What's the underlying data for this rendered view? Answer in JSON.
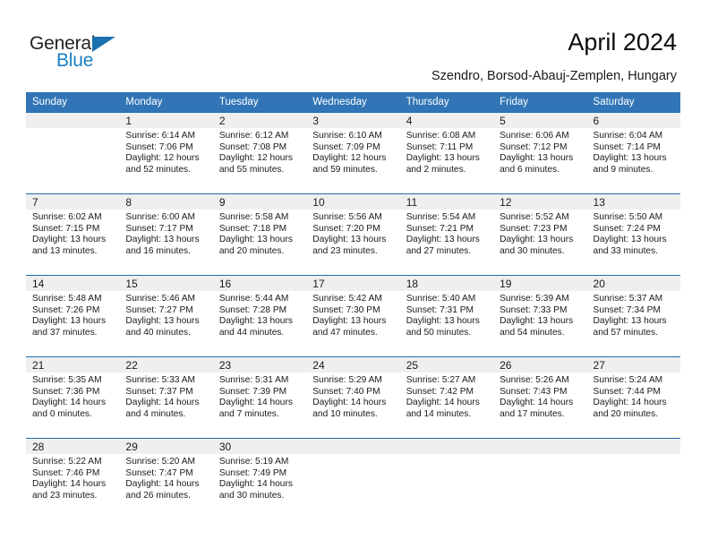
{
  "brand": {
    "name_part1": "General",
    "name_part2": "Blue",
    "triangle_color": "#1a6fb0",
    "blue_color": "#1a7fc4"
  },
  "header": {
    "title": "April 2024",
    "location": "Szendro, Borsod-Abauj-Zemplen, Hungary"
  },
  "theme": {
    "header_blue": "#3175b6",
    "separator_blue": "#1f6db3",
    "daynum_band": "#efefef"
  },
  "weekday_headers": [
    "Sunday",
    "Monday",
    "Tuesday",
    "Wednesday",
    "Thursday",
    "Friday",
    "Saturday"
  ],
  "weeks": [
    {
      "days": [
        {
          "day": "",
          "sunrise": "",
          "sunset": "",
          "daylight_line1": "",
          "daylight_line2": ""
        },
        {
          "day": "1",
          "sunrise": "Sunrise: 6:14 AM",
          "sunset": "Sunset: 7:06 PM",
          "daylight_line1": "Daylight: 12 hours",
          "daylight_line2": "and 52 minutes."
        },
        {
          "day": "2",
          "sunrise": "Sunrise: 6:12 AM",
          "sunset": "Sunset: 7:08 PM",
          "daylight_line1": "Daylight: 12 hours",
          "daylight_line2": "and 55 minutes."
        },
        {
          "day": "3",
          "sunrise": "Sunrise: 6:10 AM",
          "sunset": "Sunset: 7:09 PM",
          "daylight_line1": "Daylight: 12 hours",
          "daylight_line2": "and 59 minutes."
        },
        {
          "day": "4",
          "sunrise": "Sunrise: 6:08 AM",
          "sunset": "Sunset: 7:11 PM",
          "daylight_line1": "Daylight: 13 hours",
          "daylight_line2": "and 2 minutes."
        },
        {
          "day": "5",
          "sunrise": "Sunrise: 6:06 AM",
          "sunset": "Sunset: 7:12 PM",
          "daylight_line1": "Daylight: 13 hours",
          "daylight_line2": "and 6 minutes."
        },
        {
          "day": "6",
          "sunrise": "Sunrise: 6:04 AM",
          "sunset": "Sunset: 7:14 PM",
          "daylight_line1": "Daylight: 13 hours",
          "daylight_line2": "and 9 minutes."
        }
      ]
    },
    {
      "days": [
        {
          "day": "7",
          "sunrise": "Sunrise: 6:02 AM",
          "sunset": "Sunset: 7:15 PM",
          "daylight_line1": "Daylight: 13 hours",
          "daylight_line2": "and 13 minutes."
        },
        {
          "day": "8",
          "sunrise": "Sunrise: 6:00 AM",
          "sunset": "Sunset: 7:17 PM",
          "daylight_line1": "Daylight: 13 hours",
          "daylight_line2": "and 16 minutes."
        },
        {
          "day": "9",
          "sunrise": "Sunrise: 5:58 AM",
          "sunset": "Sunset: 7:18 PM",
          "daylight_line1": "Daylight: 13 hours",
          "daylight_line2": "and 20 minutes."
        },
        {
          "day": "10",
          "sunrise": "Sunrise: 5:56 AM",
          "sunset": "Sunset: 7:20 PM",
          "daylight_line1": "Daylight: 13 hours",
          "daylight_line2": "and 23 minutes."
        },
        {
          "day": "11",
          "sunrise": "Sunrise: 5:54 AM",
          "sunset": "Sunset: 7:21 PM",
          "daylight_line1": "Daylight: 13 hours",
          "daylight_line2": "and 27 minutes."
        },
        {
          "day": "12",
          "sunrise": "Sunrise: 5:52 AM",
          "sunset": "Sunset: 7:23 PM",
          "daylight_line1": "Daylight: 13 hours",
          "daylight_line2": "and 30 minutes."
        },
        {
          "day": "13",
          "sunrise": "Sunrise: 5:50 AM",
          "sunset": "Sunset: 7:24 PM",
          "daylight_line1": "Daylight: 13 hours",
          "daylight_line2": "and 33 minutes."
        }
      ]
    },
    {
      "days": [
        {
          "day": "14",
          "sunrise": "Sunrise: 5:48 AM",
          "sunset": "Sunset: 7:26 PM",
          "daylight_line1": "Daylight: 13 hours",
          "daylight_line2": "and 37 minutes."
        },
        {
          "day": "15",
          "sunrise": "Sunrise: 5:46 AM",
          "sunset": "Sunset: 7:27 PM",
          "daylight_line1": "Daylight: 13 hours",
          "daylight_line2": "and 40 minutes."
        },
        {
          "day": "16",
          "sunrise": "Sunrise: 5:44 AM",
          "sunset": "Sunset: 7:28 PM",
          "daylight_line1": "Daylight: 13 hours",
          "daylight_line2": "and 44 minutes."
        },
        {
          "day": "17",
          "sunrise": "Sunrise: 5:42 AM",
          "sunset": "Sunset: 7:30 PM",
          "daylight_line1": "Daylight: 13 hours",
          "daylight_line2": "and 47 minutes."
        },
        {
          "day": "18",
          "sunrise": "Sunrise: 5:40 AM",
          "sunset": "Sunset: 7:31 PM",
          "daylight_line1": "Daylight: 13 hours",
          "daylight_line2": "and 50 minutes."
        },
        {
          "day": "19",
          "sunrise": "Sunrise: 5:39 AM",
          "sunset": "Sunset: 7:33 PM",
          "daylight_line1": "Daylight: 13 hours",
          "daylight_line2": "and 54 minutes."
        },
        {
          "day": "20",
          "sunrise": "Sunrise: 5:37 AM",
          "sunset": "Sunset: 7:34 PM",
          "daylight_line1": "Daylight: 13 hours",
          "daylight_line2": "and 57 minutes."
        }
      ]
    },
    {
      "days": [
        {
          "day": "21",
          "sunrise": "Sunrise: 5:35 AM",
          "sunset": "Sunset: 7:36 PM",
          "daylight_line1": "Daylight: 14 hours",
          "daylight_line2": "and 0 minutes."
        },
        {
          "day": "22",
          "sunrise": "Sunrise: 5:33 AM",
          "sunset": "Sunset: 7:37 PM",
          "daylight_line1": "Daylight: 14 hours",
          "daylight_line2": "and 4 minutes."
        },
        {
          "day": "23",
          "sunrise": "Sunrise: 5:31 AM",
          "sunset": "Sunset: 7:39 PM",
          "daylight_line1": "Daylight: 14 hours",
          "daylight_line2": "and 7 minutes."
        },
        {
          "day": "24",
          "sunrise": "Sunrise: 5:29 AM",
          "sunset": "Sunset: 7:40 PM",
          "daylight_line1": "Daylight: 14 hours",
          "daylight_line2": "and 10 minutes."
        },
        {
          "day": "25",
          "sunrise": "Sunrise: 5:27 AM",
          "sunset": "Sunset: 7:42 PM",
          "daylight_line1": "Daylight: 14 hours",
          "daylight_line2": "and 14 minutes."
        },
        {
          "day": "26",
          "sunrise": "Sunrise: 5:26 AM",
          "sunset": "Sunset: 7:43 PM",
          "daylight_line1": "Daylight: 14 hours",
          "daylight_line2": "and 17 minutes."
        },
        {
          "day": "27",
          "sunrise": "Sunrise: 5:24 AM",
          "sunset": "Sunset: 7:44 PM",
          "daylight_line1": "Daylight: 14 hours",
          "daylight_line2": "and 20 minutes."
        }
      ]
    },
    {
      "days": [
        {
          "day": "28",
          "sunrise": "Sunrise: 5:22 AM",
          "sunset": "Sunset: 7:46 PM",
          "daylight_line1": "Daylight: 14 hours",
          "daylight_line2": "and 23 minutes."
        },
        {
          "day": "29",
          "sunrise": "Sunrise: 5:20 AM",
          "sunset": "Sunset: 7:47 PM",
          "daylight_line1": "Daylight: 14 hours",
          "daylight_line2": "and 26 minutes."
        },
        {
          "day": "30",
          "sunrise": "Sunrise: 5:19 AM",
          "sunset": "Sunset: 7:49 PM",
          "daylight_line1": "Daylight: 14 hours",
          "daylight_line2": "and 30 minutes."
        },
        {
          "day": "",
          "sunrise": "",
          "sunset": "",
          "daylight_line1": "",
          "daylight_line2": ""
        },
        {
          "day": "",
          "sunrise": "",
          "sunset": "",
          "daylight_line1": "",
          "daylight_line2": ""
        },
        {
          "day": "",
          "sunrise": "",
          "sunset": "",
          "daylight_line1": "",
          "daylight_line2": ""
        },
        {
          "day": "",
          "sunrise": "",
          "sunset": "",
          "daylight_line1": "",
          "daylight_line2": ""
        }
      ]
    }
  ]
}
